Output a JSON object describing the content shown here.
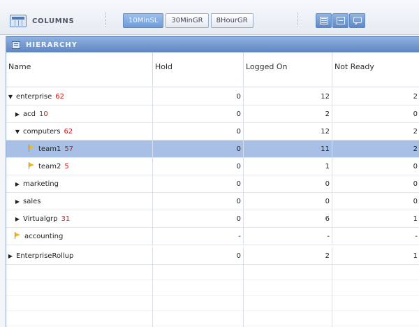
{
  "toolbar": {
    "columns_label": "COLUMNS",
    "intervals": [
      {
        "label": "10MinSL",
        "active": true
      },
      {
        "label": "30MinGR",
        "active": false
      },
      {
        "label": "8HourGR",
        "active": false
      }
    ],
    "view_buttons": [
      "grid-view-icon",
      "list-view-icon",
      "chat-view-icon"
    ]
  },
  "panel": {
    "title": "HIERARCHY",
    "columns": [
      "Name",
      "Hold",
      "Logged On",
      "Not Ready"
    ],
    "rows": [
      {
        "name": "enterprise",
        "count": "62",
        "arrow": "▼",
        "flag": false,
        "hold": "0",
        "logged_on": "12",
        "not_ready": "2",
        "selected": false
      },
      {
        "name": "acd",
        "count": "10",
        "arrow": "▶",
        "flag": false,
        "hold": "0",
        "logged_on": "2",
        "not_ready": "0",
        "selected": false
      },
      {
        "name": "computers",
        "count": "62",
        "arrow": "▼",
        "flag": false,
        "hold": "0",
        "logged_on": "12",
        "not_ready": "2",
        "selected": false
      },
      {
        "name": "team1",
        "count": "57",
        "arrow": "",
        "flag": true,
        "hold": "0",
        "logged_on": "11",
        "not_ready": "2",
        "selected": true
      },
      {
        "name": "team2",
        "count": "5",
        "arrow": "",
        "flag": true,
        "hold": "0",
        "logged_on": "1",
        "not_ready": "0",
        "selected": false
      },
      {
        "name": "marketing",
        "count": "",
        "arrow": "▶",
        "flag": false,
        "hold": "0",
        "logged_on": "0",
        "not_ready": "0",
        "selected": false
      },
      {
        "name": "sales",
        "count": "",
        "arrow": "▶",
        "flag": false,
        "hold": "0",
        "logged_on": "0",
        "not_ready": "0",
        "selected": false
      },
      {
        "name": "Virtualgrp",
        "count": "31",
        "arrow": "▶",
        "flag": false,
        "hold": "0",
        "logged_on": "6",
        "not_ready": "1",
        "selected": false
      },
      {
        "name": "accounting",
        "count": "",
        "arrow": "",
        "flag": true,
        "hold": "-",
        "logged_on": "-",
        "not_ready": "-",
        "selected": false
      },
      {
        "name": "EnterpriseRollup",
        "count": "",
        "arrow": "▶",
        "flag": false,
        "hold": "0",
        "logged_on": "2",
        "not_ready": "1",
        "selected": false
      }
    ]
  },
  "colors": {
    "selected_row": "#a8c0e6",
    "count_red": "#c11a1a",
    "header_blue": "#6f97cf"
  }
}
